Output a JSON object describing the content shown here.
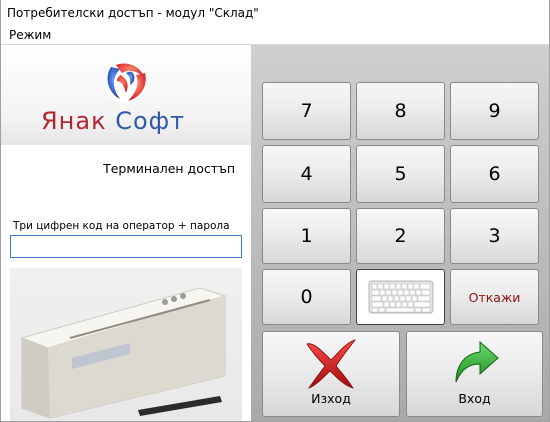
{
  "window": {
    "title": "Потребителски достъп - модул \"Склад\""
  },
  "menu": {
    "items": [
      {
        "label": "Режим"
      }
    ]
  },
  "logo": {
    "word1": "Янак",
    "word2": "Софт",
    "colors": {
      "red": "#b4262e",
      "blue": "#2e5aa8"
    }
  },
  "login": {
    "heading": "Терминален достъп",
    "code_label": "Три цифрен код на оператор + парола",
    "code_value": ""
  },
  "keypad": {
    "digits": [
      "7",
      "8",
      "9",
      "4",
      "5",
      "6",
      "1",
      "2",
      "3",
      "0"
    ],
    "keyboard_icon": "keyboard-icon",
    "cancel_label": "Откажи",
    "exit_label": "Изход",
    "exit_icon": "red-x-icon",
    "enter_label": "Вход",
    "enter_icon": "green-arrow-icon"
  },
  "reader_image": "magnetic-card-reader"
}
